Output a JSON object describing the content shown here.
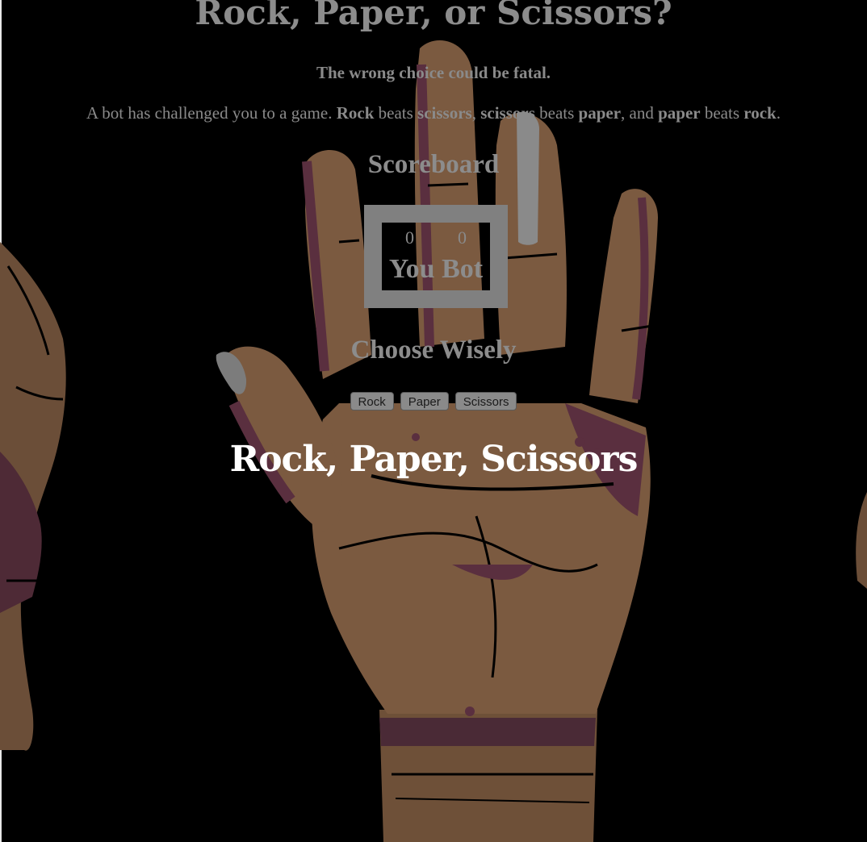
{
  "page": {
    "title": "Rock, Paper, or Scissors?",
    "tagline": "The wrong choice could be fatal.",
    "intro": {
      "prefix": "A bot has challenged you to a game. ",
      "w1": "Rock",
      "t1": " beats ",
      "w2": "scissors",
      "t2": ", ",
      "w3": "scissors",
      "t3": " beats ",
      "w4": "paper",
      "t4": ", and ",
      "w5": "paper",
      "t5": " beats ",
      "w6": "rock",
      "suffix": "."
    }
  },
  "scoreboard": {
    "heading": "Scoreboard",
    "you_score": "0",
    "bot_score": "0",
    "you_label": "You",
    "bot_label": "Bot"
  },
  "choices": {
    "heading": "Choose Wisely",
    "rock": "Rock",
    "paper": "Paper",
    "scissors": "Scissors"
  },
  "result": {
    "message": "Rock, Paper, Scissors"
  },
  "colors": {
    "background": "#000000",
    "muted_text": "#8a8a8a",
    "result_text": "#ffffff",
    "skin": "#7b5a40",
    "shadow": "#5a2f3f"
  }
}
